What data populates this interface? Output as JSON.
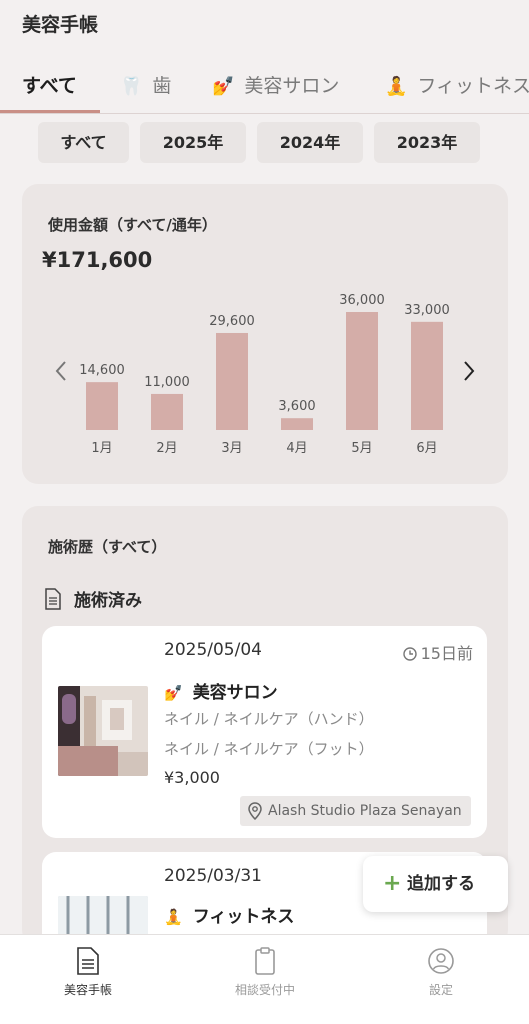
{
  "header": {
    "title": "美容手帳"
  },
  "tabs": [
    {
      "label": "すべて",
      "icon": ""
    },
    {
      "label": "歯",
      "icon": "🦷"
    },
    {
      "label": "美容サロン",
      "icon": "💅"
    },
    {
      "label": "フィットネス",
      "icon": "🧘"
    }
  ],
  "year_filters": [
    "すべて",
    "2025年",
    "2024年",
    "2023年"
  ],
  "spending": {
    "title": "使用金額（すべて/通年）",
    "total": "¥171,600",
    "prev_icon": "chevron-left-icon",
    "next_icon": "chevron-right-icon"
  },
  "chart_data": {
    "type": "bar",
    "categories": [
      "1月",
      "2月",
      "3月",
      "4月",
      "5月",
      "6月"
    ],
    "values": [
      14600,
      11000,
      29600,
      3600,
      36000,
      33000
    ],
    "value_labels": [
      "14,600",
      "11,000",
      "29,600",
      "3,600",
      "36,000",
      "33,000"
    ],
    "bar_color": "#d4ada8",
    "ylim": [
      0,
      36000
    ]
  },
  "history": {
    "title": "施術歴（すべて）",
    "done_label": "施術済み",
    "records": [
      {
        "date": "2025/05/04",
        "ago": "15日前",
        "category_icon": "💅",
        "category": "美容サロン",
        "lines": [
          "ネイル / ネイルケア（ハンド）",
          "ネイル / ネイルケア（フット）"
        ],
        "price": "¥3,000",
        "location": "Alash Studio Plaza Senayan"
      },
      {
        "date": "2025/03/31",
        "category_icon": "🧘",
        "category": "フィットネス"
      }
    ]
  },
  "add_button": {
    "label": "追加する"
  },
  "bottom_nav": [
    {
      "label": "美容手帳"
    },
    {
      "label": "相談受付中"
    },
    {
      "label": "設定"
    }
  ],
  "colors": {
    "accent": "#c98f86",
    "background": "#f3f0f0",
    "card": "#ebe6e5",
    "plus": "#6aa84f"
  }
}
